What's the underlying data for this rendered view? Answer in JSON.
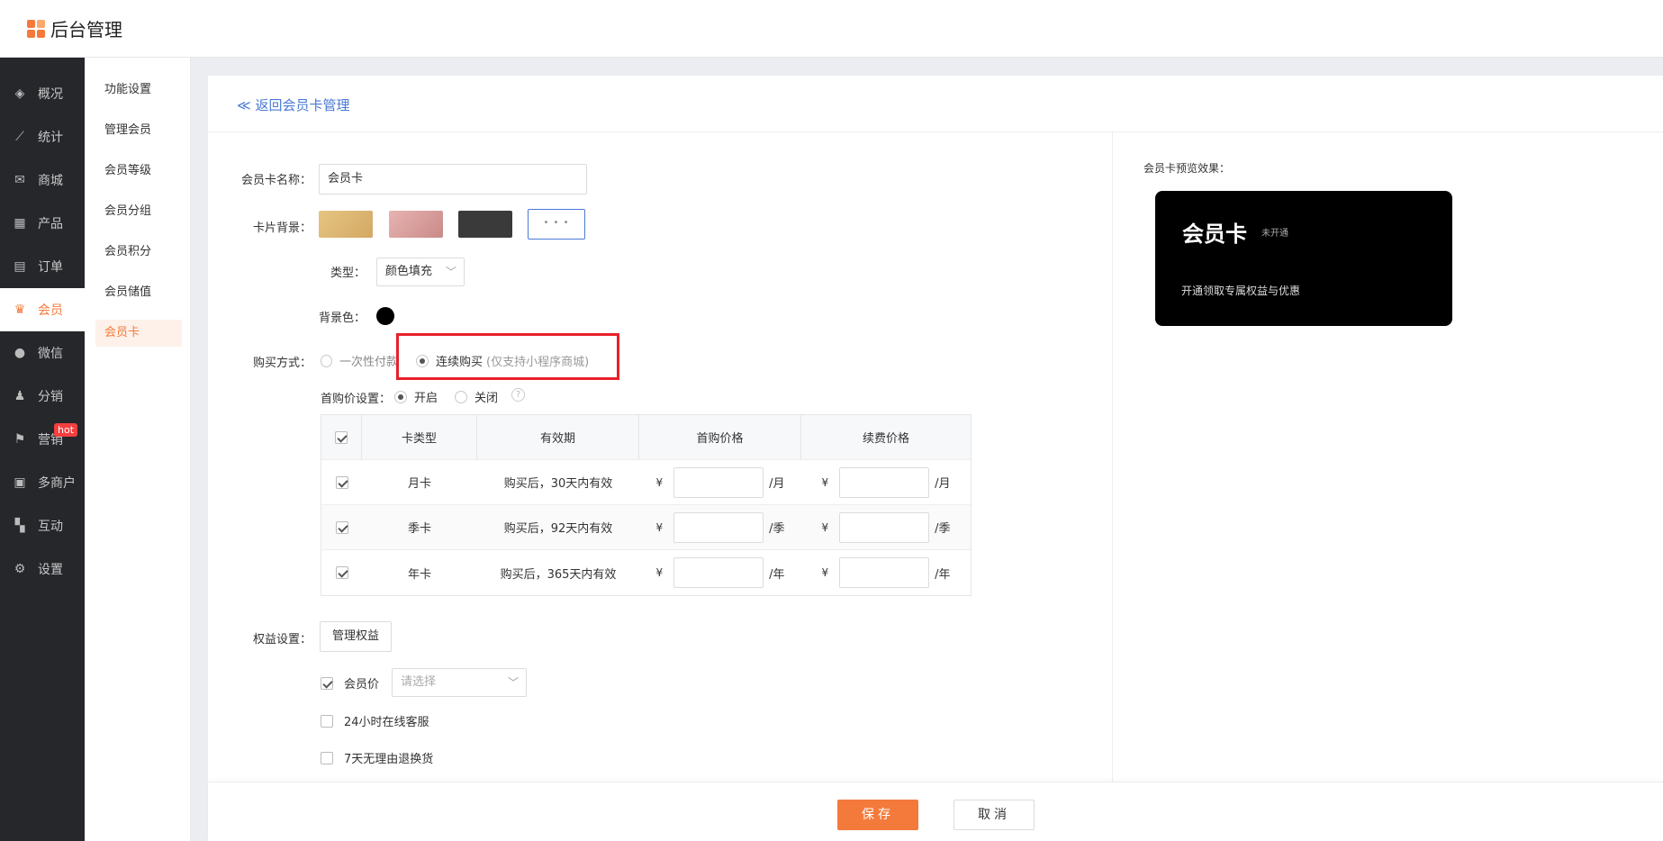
{
  "app": {
    "title": "后台管理"
  },
  "sidebar": {
    "items": [
      {
        "label": "概况",
        "icon": "layers-icon"
      },
      {
        "label": "统计",
        "icon": "chart-icon"
      },
      {
        "label": "商城",
        "icon": "mail-icon"
      },
      {
        "label": "产品",
        "icon": "grid-icon"
      },
      {
        "label": "订单",
        "icon": "clipboard-icon"
      },
      {
        "label": "会员",
        "icon": "crown-icon"
      },
      {
        "label": "微信",
        "icon": "wechat-icon"
      },
      {
        "label": "分销",
        "icon": "user-share-icon"
      },
      {
        "label": "营销",
        "icon": "flag-icon",
        "badge": "hot"
      },
      {
        "label": "多商户",
        "icon": "store-icon"
      },
      {
        "label": "互动",
        "icon": "blocks-icon"
      },
      {
        "label": "设置",
        "icon": "gear-icon"
      }
    ],
    "active": "会员",
    "accent": "#f47a3c"
  },
  "subnav": {
    "items": [
      "功能设置",
      "管理会员",
      "会员等级",
      "会员分组",
      "会员积分",
      "会员储值",
      "会员卡"
    ],
    "active": "会员卡"
  },
  "page": {
    "back_link": "≪ 返回会员卡管理"
  },
  "form": {
    "card_name_label": "会员卡名称：",
    "card_name_value": "会员卡",
    "card_bg_label": "卡片背景：",
    "more_swatch": "• • •",
    "type_label": "类型：",
    "type_value": "颜色填充",
    "bg_color_label": "背景色：",
    "bg_color": "#000000",
    "purchase_label": "购买方式：",
    "purchase_once": "一次性付款",
    "purchase_continuous": "连续购买",
    "purchase_continuous_hint": "(仅支持小程序商城)",
    "first_price_label": "首购价设置：",
    "first_price_on": "开启",
    "first_price_off": "关闭",
    "help_mark": "?"
  },
  "table": {
    "headers": [
      "卡类型",
      "有效期",
      "首购价格",
      "续费价格"
    ],
    "rows": [
      {
        "type": "月卡",
        "validity": "购买后，30天内有效",
        "unit": "/月"
      },
      {
        "type": "季卡",
        "validity": "购买后，92天内有效",
        "unit": "/季"
      },
      {
        "type": "年卡",
        "validity": "购买后，365天内有效",
        "unit": "/年"
      }
    ],
    "currency": "¥"
  },
  "benefits": {
    "label": "权益设置：",
    "manage_button": "管理权益",
    "items": [
      {
        "label": "会员价",
        "checked": true
      },
      {
        "label": "24小时在线客服",
        "checked": false
      },
      {
        "label": "7天无理由退换货",
        "checked": false
      }
    ],
    "member_price_placeholder": "请选择"
  },
  "preview": {
    "label": "会员卡预览效果：",
    "title": "会员卡",
    "status": "未开通",
    "desc": "开通领取专属权益与优惠"
  },
  "footer": {
    "save": "保存",
    "cancel": "取消"
  }
}
